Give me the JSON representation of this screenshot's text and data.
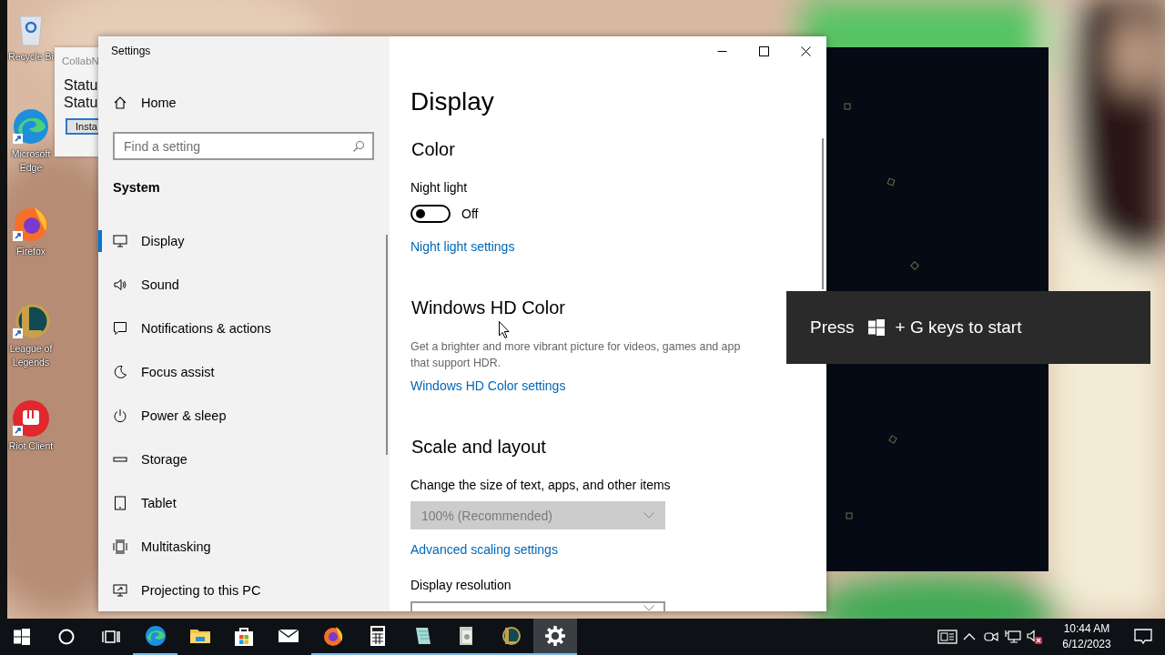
{
  "desktop": {
    "icons": [
      {
        "label": "Recycle Bi"
      },
      {
        "label": "Microsoft Edge"
      },
      {
        "label": "Firefox"
      },
      {
        "label": "League of Legends"
      },
      {
        "label": "Riot Client"
      }
    ]
  },
  "background_window": {
    "title": "CollabN",
    "lines": [
      "Statu",
      "Statu"
    ],
    "button": "Insta"
  },
  "settings": {
    "title": "Settings",
    "home": "Home",
    "search": {
      "placeholder": "Find a setting"
    },
    "section": "System",
    "nav": [
      {
        "label": "Display",
        "selected": true
      },
      {
        "label": "Sound",
        "selected": false
      },
      {
        "label": "Notifications & actions",
        "selected": false
      },
      {
        "label": "Focus assist",
        "selected": false
      },
      {
        "label": "Power & sleep",
        "selected": false
      },
      {
        "label": "Storage",
        "selected": false
      },
      {
        "label": "Tablet",
        "selected": false
      },
      {
        "label": "Multitasking",
        "selected": false
      },
      {
        "label": "Projecting to this PC",
        "selected": false
      }
    ],
    "page_title": "Display",
    "content": [
      {
        "kind": "heading",
        "text": "Color"
      },
      {
        "kind": "label",
        "text": "Night light"
      },
      {
        "kind": "toggle",
        "on": false,
        "state_text": "Off"
      },
      {
        "kind": "link",
        "text": "Night light settings"
      },
      {
        "kind": "heading",
        "text": "Windows HD Color"
      },
      {
        "kind": "text",
        "lines": [
          "Get a brighter and more vibrant picture for videos, games and app",
          "that support HDR."
        ]
      },
      {
        "kind": "link",
        "text": "Windows HD Color settings"
      },
      {
        "kind": "heading",
        "text": "Scale and layout"
      },
      {
        "kind": "label",
        "text": "Change the size of text, apps, and other items"
      },
      {
        "kind": "dropdown",
        "value": "100% (Recommended)",
        "disabled": true
      },
      {
        "kind": "link",
        "text": "Advanced scaling settings"
      },
      {
        "kind": "label",
        "text": "Display resolution"
      },
      {
        "kind": "dropdown",
        "disabled": false
      }
    ]
  },
  "game_bar": {
    "hint_before": "Press",
    "hint_after": "+ G keys to start"
  },
  "taskbar": {
    "apps": [
      {
        "running": true,
        "selected": false
      },
      {
        "running": false,
        "selected": false
      },
      {
        "running": false,
        "selected": false
      },
      {
        "running": false,
        "selected": false
      },
      {
        "running": true,
        "selected": false
      },
      {
        "running": true,
        "selected": false
      },
      {
        "running": true,
        "selected": false
      },
      {
        "running": true,
        "selected": false
      },
      {
        "running": true,
        "selected": false
      },
      {
        "running": true,
        "selected": true
      }
    ],
    "clock": {
      "time": "10:44 AM",
      "date": "6/12/2023"
    }
  }
}
